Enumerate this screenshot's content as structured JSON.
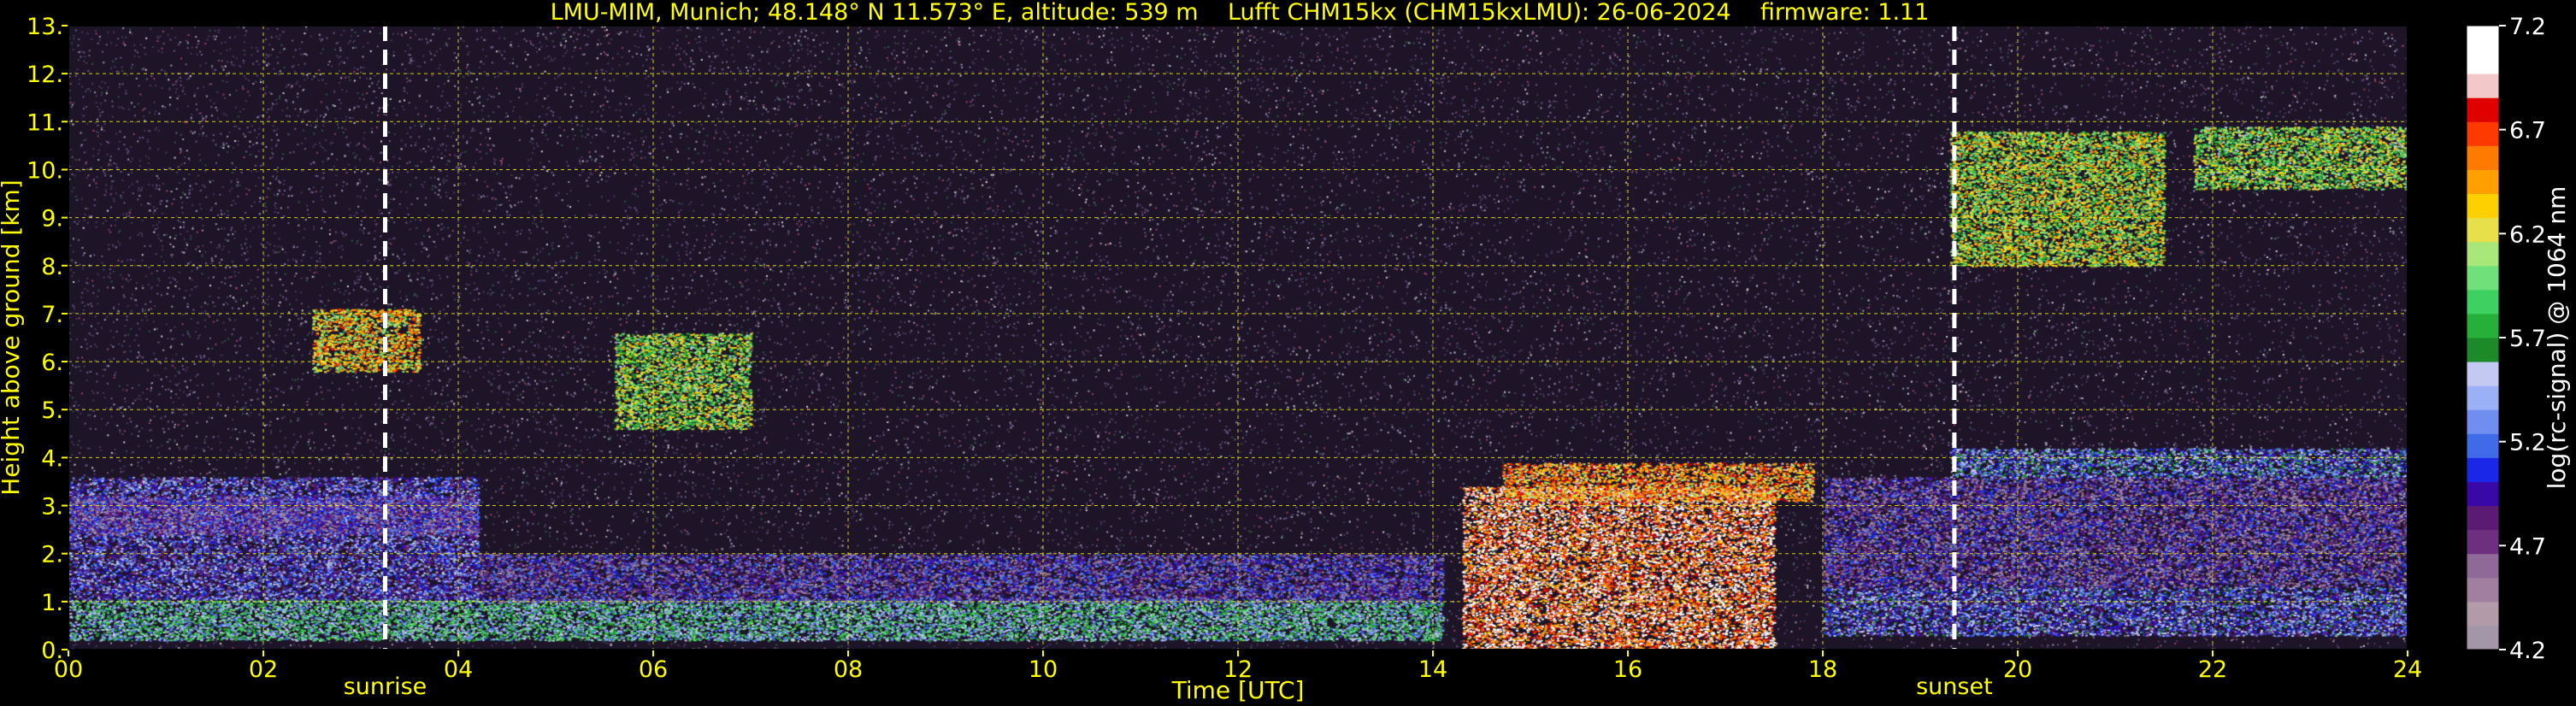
{
  "title": "LMU-MIM, Munich; 48.148° N 11.573° E, altitude: 539 m    Lufft CHM15kx (CHM15kxLMU): 26-06-2024    firmware: 1.11",
  "chart_data": {
    "type": "heatmap",
    "xlabel": "Time [UTC]",
    "ylabel": "Height above ground [km]",
    "xlim": [
      0,
      24
    ],
    "ylim": [
      0,
      13
    ],
    "x_ticks": [
      "00",
      "02",
      "04",
      "06",
      "08",
      "10",
      "12",
      "14",
      "16",
      "18",
      "20",
      "22",
      "24"
    ],
    "y_ticks": [
      "0.",
      "1.",
      "2.",
      "3.",
      "4.",
      "5.",
      "6.",
      "7.",
      "8.",
      "9.",
      "10.",
      "11.",
      "12.",
      "13."
    ],
    "grid": true,
    "grid_color": "#ffff00",
    "markers": [
      {
        "label": "sunrise",
        "time": 3.25
      },
      {
        "label": "sunset",
        "time": 19.35
      }
    ],
    "colorbar": {
      "label": "log(rc-signal) @ 1064 nm",
      "range": [
        4.2,
        7.2
      ],
      "ticks": [
        "7.2",
        "6.7",
        "6.2",
        "5.7",
        "5.2",
        "4.7",
        "4.2"
      ],
      "colors": [
        "#a296a8",
        "#b39aa9",
        "#a07fa0",
        "#8f6a99",
        "#6e2f7e",
        "#5b1a73",
        "#3b08a8",
        "#1a27e8",
        "#3f6be8",
        "#6f8ef0",
        "#9bb0f5",
        "#c4c9f2",
        "#1d8a2a",
        "#26b03a",
        "#3ed060",
        "#6fe07a",
        "#a8e87a",
        "#e8e04a",
        "#ffd000",
        "#ffa000",
        "#ff7a00",
        "#ff3a00",
        "#e00000",
        "#f2c8c8",
        "#ffffff",
        "#ffffff"
      ]
    },
    "features": [
      {
        "name": "boundary-layer-low",
        "t0": 0,
        "t1": 14.1,
        "h0": 0.2,
        "h1": 1.05,
        "value": 5.6
      },
      {
        "name": "residual-layer",
        "t0": 0,
        "t1": 4.2,
        "h0": 1.05,
        "h1": 3.6,
        "value": 5.1
      },
      {
        "name": "residual-layer-upper",
        "t0": 0,
        "t1": 4.2,
        "h0": 2.4,
        "h1": 3.2,
        "value": 4.8
      },
      {
        "name": "mid-aerosol",
        "t0": 4.2,
        "t1": 14.1,
        "h0": 1.0,
        "h1": 2.0,
        "value": 4.9
      },
      {
        "name": "convective-cloud-base",
        "t0": 14.3,
        "t1": 17.5,
        "h0": 0.0,
        "h1": 3.4,
        "value": 6.8
      },
      {
        "name": "convective-cloud-edge",
        "t0": 14.7,
        "t1": 17.9,
        "h0": 3.1,
        "h1": 3.9,
        "value": 6.5
      },
      {
        "name": "evening-layer",
        "t0": 18.0,
        "t1": 24,
        "h0": 0.3,
        "h1": 1.3,
        "value": 5.2
      },
      {
        "name": "evening-residual",
        "t0": 18.0,
        "t1": 24,
        "h0": 1.3,
        "h1": 3.6,
        "value": 4.8
      },
      {
        "name": "evening-top",
        "t0": 19.3,
        "t1": 24,
        "h0": 3.6,
        "h1": 4.2,
        "value": 5.3
      },
      {
        "name": "cirrus-morning",
        "t0": 2.5,
        "t1": 3.6,
        "h0": 5.8,
        "h1": 7.1,
        "value": 6.3
      },
      {
        "name": "cirrus-morning-2",
        "t0": 5.6,
        "t1": 7.0,
        "h0": 4.6,
        "h1": 6.6,
        "value": 6.0
      },
      {
        "name": "cirrus-evening",
        "t0": 19.3,
        "t1": 21.5,
        "h0": 8.0,
        "h1": 10.8,
        "value": 6.1
      },
      {
        "name": "cirrus-evening-2",
        "t0": 21.8,
        "t1": 24,
        "h0": 9.6,
        "h1": 10.9,
        "value": 6.0
      }
    ]
  }
}
